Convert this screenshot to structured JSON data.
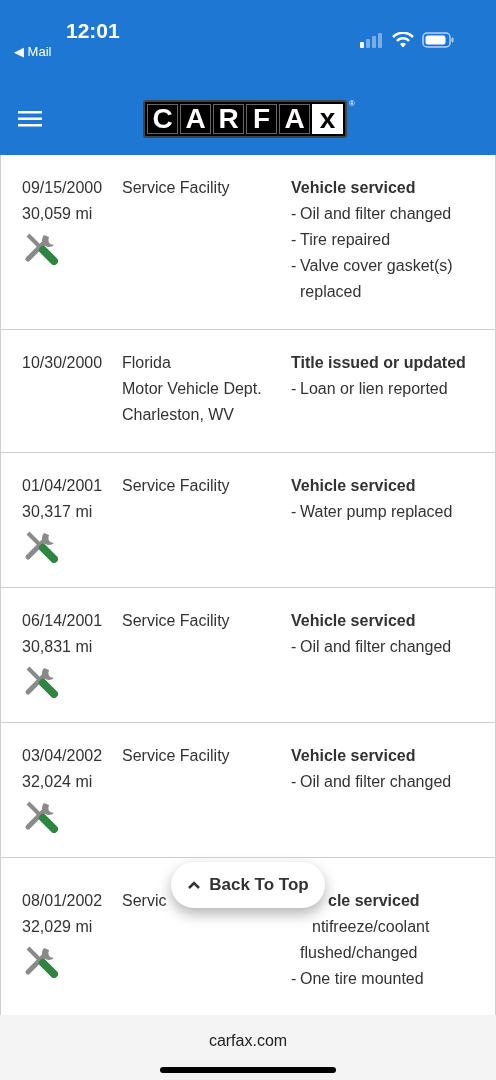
{
  "status_bar": {
    "time": "12:01",
    "back_label": "◀ Mail"
  },
  "header": {
    "logo": {
      "letters": [
        "C",
        "A",
        "R",
        "F",
        "A",
        "x"
      ],
      "mark": "®"
    }
  },
  "records": [
    {
      "kind": "service",
      "date": "09/15/2000",
      "mileage": "30,059 mi",
      "location": [
        "Service Facility"
      ],
      "title": "Vehicle serviced",
      "items": [
        {
          "bullet": "-",
          "text": "Oil and filter changed"
        },
        {
          "bullet": "-",
          "text": "Tire repaired"
        },
        {
          "bullet": "-",
          "text": "Valve cover gasket(s) replaced"
        }
      ]
    },
    {
      "kind": "title",
      "date": "10/30/2000",
      "location": [
        "Florida",
        "Motor Vehicle Dept.",
        "Charleston, WV"
      ],
      "title": "Title issued or updated",
      "items": [
        {
          "bullet": "-",
          "text": "Loan or lien reported"
        }
      ]
    },
    {
      "kind": "service",
      "date": "01/04/2001",
      "mileage": "30,317 mi",
      "location": [
        "Service Facility"
      ],
      "title": "Vehicle serviced",
      "items": [
        {
          "bullet": "-",
          "text": "Water pump replaced"
        }
      ]
    },
    {
      "kind": "service",
      "date": "06/14/2001",
      "mileage": "30,831 mi",
      "location": [
        "Service Facility"
      ],
      "title": "Vehicle serviced",
      "items": [
        {
          "bullet": "-",
          "text": "Oil and filter changed"
        }
      ]
    },
    {
      "kind": "service",
      "date": "03/04/2002",
      "mileage": "32,024 mi",
      "location": [
        "Service Facility"
      ],
      "title": "Vehicle serviced",
      "items": [
        {
          "bullet": "-",
          "text": "Oil and filter changed"
        }
      ]
    },
    {
      "kind": "service-covered",
      "date": "08/01/2002",
      "mileage": "32,029 mi",
      "location": [
        "Servic"
      ],
      "title": "cle serviced",
      "items": [
        {
          "text": "ntifreeze/coolant flushed/changed"
        },
        {
          "bullet": "-",
          "text": "One tire mounted"
        }
      ]
    }
  ],
  "back_to_top": {
    "label": "Back To Top"
  },
  "browser_bar": {
    "url": "carfax.com"
  }
}
